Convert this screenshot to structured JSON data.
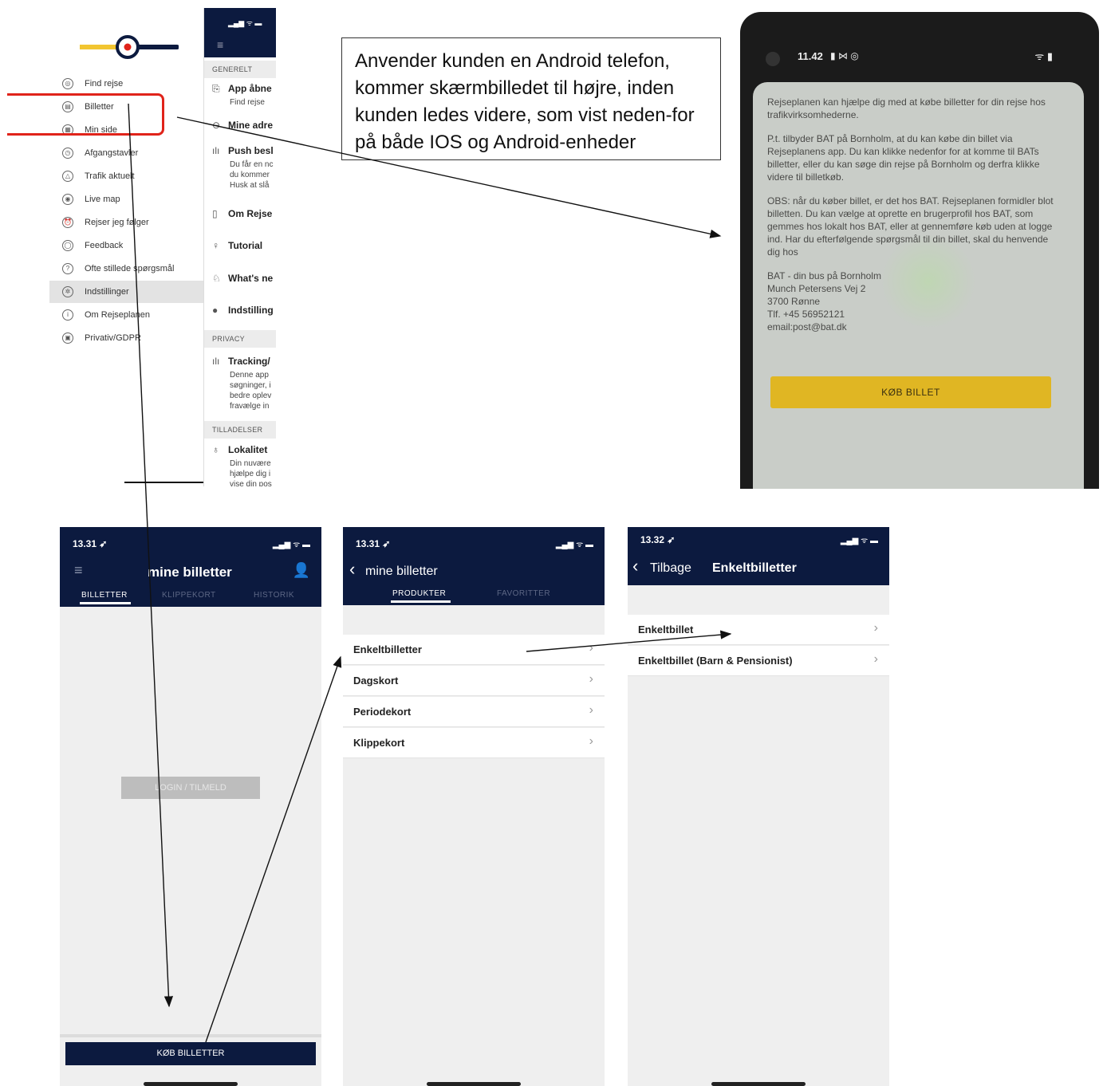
{
  "drawer": {
    "menu": [
      {
        "label": "Find rejse",
        "icon": "target-icon"
      },
      {
        "label": "Billetter",
        "icon": "ticket-icon"
      },
      {
        "label": "Min side",
        "icon": "grid-icon"
      },
      {
        "label": "Afgangstavler",
        "icon": "clock-icon"
      },
      {
        "label": "Trafik aktuelt",
        "icon": "warning-icon"
      },
      {
        "label": "Live map",
        "icon": "map-icon"
      },
      {
        "label": "Rejser jeg følger",
        "icon": "alarm-icon"
      },
      {
        "label": "Feedback",
        "icon": "chat-icon"
      },
      {
        "label": "Ofte stillede spørgsmål",
        "icon": "question-icon"
      },
      {
        "label": "Indstillinger",
        "icon": "gear-icon"
      },
      {
        "label": "Om Rejseplanen",
        "icon": "info-icon"
      },
      {
        "label": "Privativ/GDPR",
        "icon": "lock-icon"
      }
    ],
    "active_index": 9,
    "highlight_color": "#e0231a",
    "logo_yellow": "#f2c530",
    "logo_navy": "#0c1a3f"
  },
  "settings": {
    "sections": [
      "GENERELT",
      "PRIVACY",
      "TILLADELSER"
    ],
    "items": [
      {
        "label": "App åbne",
        "sub": "Find rejse"
      },
      {
        "label": "Mine adre",
        "sub": ""
      },
      {
        "label": "Push besl",
        "sub": "Du får en nc\ndu kommer\nHusk at slå"
      },
      {
        "label": "Om Rejse",
        "sub": ""
      },
      {
        "label": "Tutorial",
        "sub": ""
      },
      {
        "label": "What's ne",
        "sub": ""
      },
      {
        "label": "Indstilling",
        "sub": ""
      },
      {
        "label": "Tracking/",
        "sub": "Denne app\nsøgninger, i\nbedre oplev\nfravælge in"
      },
      {
        "label": "Lokalitet",
        "sub": "Din nuvære\nhjælpe dig i\nvise din pos"
      }
    ]
  },
  "caption": {
    "text": "Anvender kunden en Android telefon, kommer skærmbilledet til højre, inden kunden ledes videre, som vist neden-for på både IOS og Android-enheder"
  },
  "android": {
    "time": "11.42",
    "status_icons": "▮ ⋈ ◎",
    "paragraphs": [
      "Rejseplanen kan hjælpe dig med at købe billetter for din rejse hos trafikvirksomhederne.",
      "P.t. tilbyder BAT på Bornholm, at du kan købe din billet via Rejseplanens app. Du kan klikke nedenfor for at komme til BATs billetter, eller du kan søge din rejse på Bornholm og derfra klikke videre til billetkøb.",
      "OBS: når du køber billet, er det hos BAT. Rejseplanen formidler blot billetten. Du kan vælge at oprette en brugerprofil hos BAT, som gemmes hos lokalt hos BAT, eller at gennemføre køb uden at logge ind. Har du efterfølgende spørgsmål til din billet, skal du henvende dig hos"
    ],
    "address": [
      "BAT - din bus på Bornholm",
      "Munch Petersens Vej 2",
      "3700 Rønne",
      "Tlf. +45 56952121",
      "email:post@bat.dk"
    ],
    "button": "KØB BILLET"
  },
  "screen1": {
    "time": "13.31 ➶",
    "title": "mine billetter",
    "tabs": [
      "BILLETTER",
      "KLIPPEKORT",
      "HISTORIK"
    ],
    "login": "LOGIN / TILMELD",
    "buy": "KØB BILLETTER"
  },
  "screen2": {
    "time": "13.31 ➶",
    "title": "mine billetter",
    "tabs": [
      "PRODUKTER",
      "FAVORITTER"
    ],
    "rows": [
      "Enkeltbilletter",
      "Dagskort",
      "Periodekort",
      "Klippekort"
    ]
  },
  "screen3": {
    "time": "13.32 ➶",
    "back": "Tilbage",
    "title": "Enkeltbilletter",
    "rows": [
      "Enkeltbillet",
      "Enkeltbillet (Barn & Pensionist)"
    ]
  }
}
